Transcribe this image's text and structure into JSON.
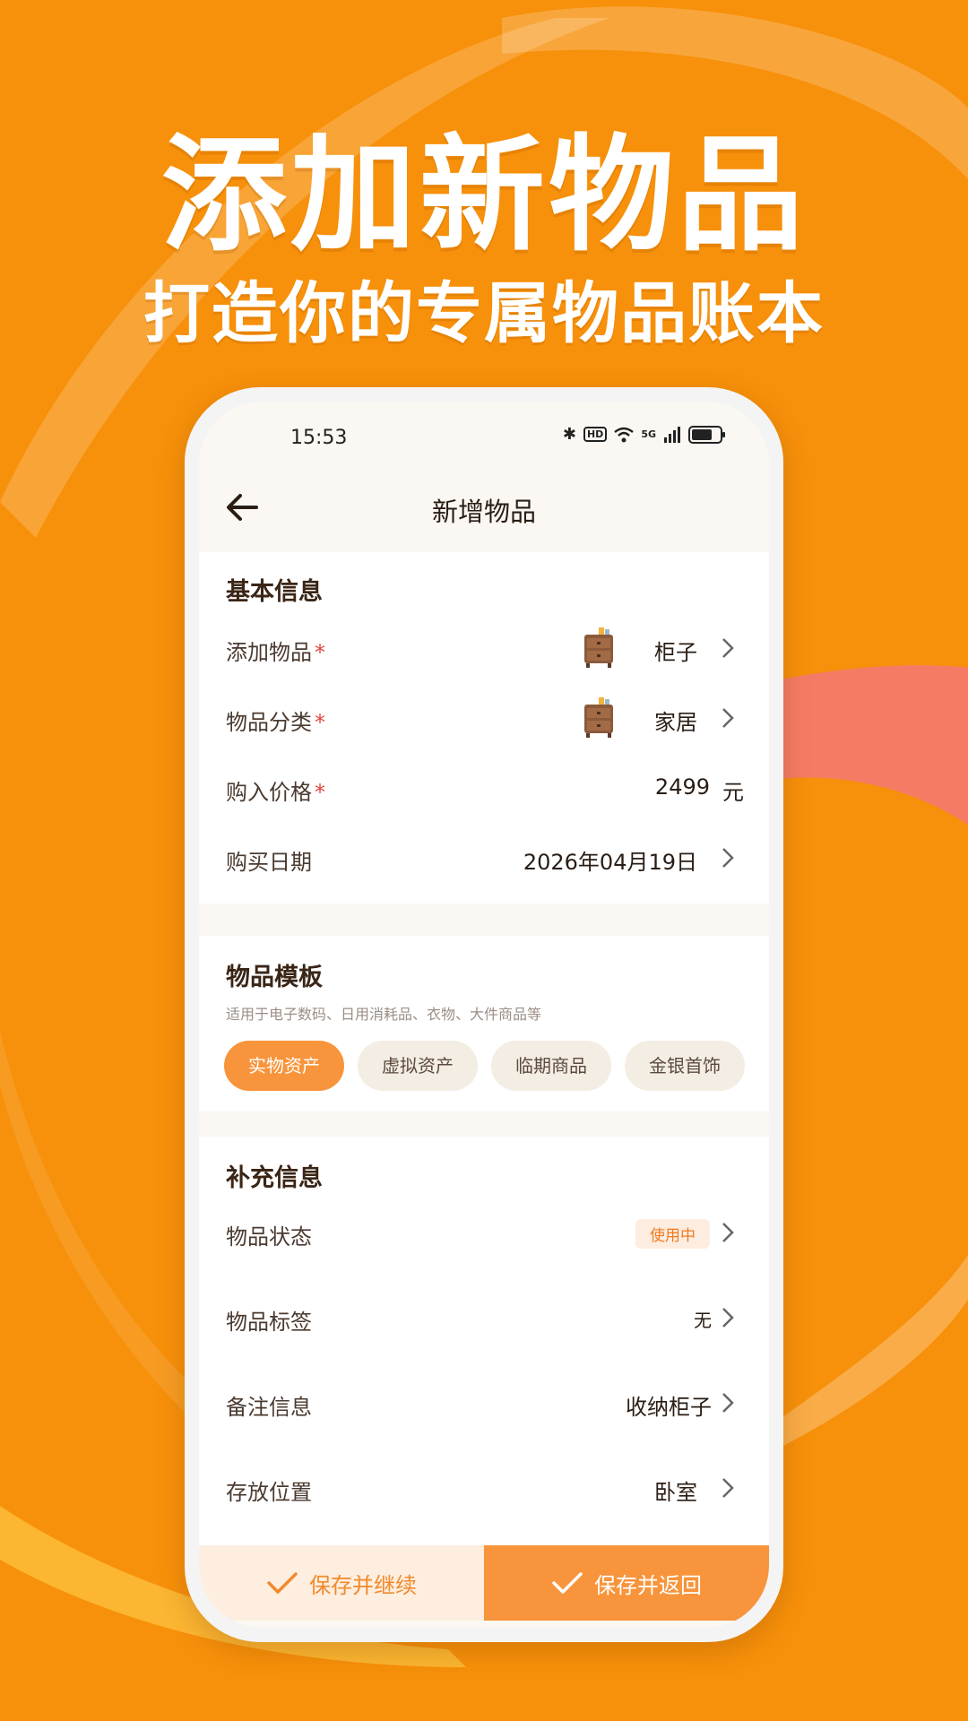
{
  "promo": {
    "title": "添加新物品",
    "subtitle": "打造你的专属物品账本"
  },
  "statusbar": {
    "time": "15:53",
    "hd": "HD",
    "signal": "5G"
  },
  "nav": {
    "title": "新增物品"
  },
  "basic": {
    "title": "基本信息",
    "rows": [
      {
        "label": "添加物品",
        "value": "柜子",
        "required": "*"
      },
      {
        "label": "物品分类",
        "value": "家居",
        "required": "*"
      },
      {
        "label": "购入价格",
        "value": "2499",
        "unit": "元",
        "required": "*"
      },
      {
        "label": "购买日期",
        "value": "2026年04月19日"
      }
    ]
  },
  "template": {
    "title": "物品模板",
    "description": "适用于电子数码、日用消耗品、衣物、大件商品等",
    "options": [
      "实物资产",
      "虚拟资产",
      "临期商品",
      "金银首饰"
    ],
    "selected": "实物资产"
  },
  "extra": {
    "title": "补充信息",
    "rows": [
      {
        "label": "物品状态",
        "value": "使用中"
      },
      {
        "label": "物品标签",
        "value": "无"
      },
      {
        "label": "备注信息",
        "value": "收纳柜子"
      },
      {
        "label": "存放位置",
        "value": "卧室"
      }
    ]
  },
  "actions": {
    "save_continue": "保存并继续",
    "save_return": "保存并返回"
  },
  "colors": {
    "background": "#f7900a",
    "accent": "#f8943b",
    "required": "#e4463b"
  }
}
